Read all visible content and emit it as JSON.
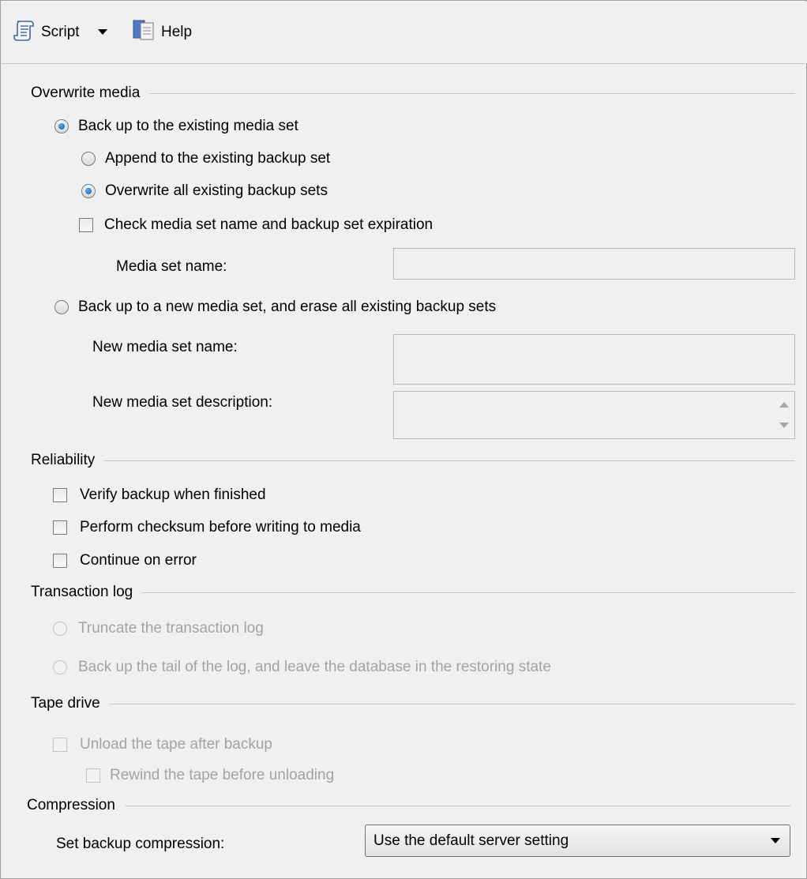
{
  "toolbar": {
    "script_label": "Script",
    "help_label": "Help"
  },
  "overwrite_media": {
    "title": "Overwrite media",
    "existing_media_set": {
      "label": "Back up to the existing media set",
      "checked": true
    },
    "append_backup_set": {
      "label": "Append to the existing backup set",
      "checked": false
    },
    "overwrite_backup_sets": {
      "label": "Overwrite all existing backup sets",
      "checked": true
    },
    "check_media_set": {
      "label": "Check media set name and backup set expiration",
      "checked": false
    },
    "media_set_name": {
      "label": "Media set name:",
      "value": ""
    },
    "new_media_set": {
      "label": "Back up to a new media set, and erase all existing backup sets",
      "checked": false
    },
    "new_media_set_name": {
      "label": "New media set name:",
      "value": ""
    },
    "new_media_set_description": {
      "label": "New media set description:",
      "value": ""
    }
  },
  "reliability": {
    "title": "Reliability",
    "verify": {
      "label": "Verify backup when finished",
      "checked": false
    },
    "checksum": {
      "label": "Perform checksum before writing to media",
      "checked": false
    },
    "continue_on_error": {
      "label": "Continue on error",
      "checked": false
    }
  },
  "transaction_log": {
    "title": "Transaction log",
    "truncate": {
      "label": "Truncate the transaction log",
      "enabled": false
    },
    "tail": {
      "label": "Back up the tail of the log, and leave the database in the restoring state",
      "enabled": false
    }
  },
  "tape_drive": {
    "title": "Tape drive",
    "unload": {
      "label": "Unload the tape after backup",
      "enabled": false
    },
    "rewind": {
      "label": "Rewind the tape before unloading",
      "enabled": false
    }
  },
  "compression": {
    "title": "Compression",
    "label": "Set backup compression:",
    "selected": "Use the default server setting"
  },
  "colors": {
    "background": "#f0f0f0",
    "disabled_text": "#a3a3a3",
    "separator": "#c8c8c8"
  }
}
